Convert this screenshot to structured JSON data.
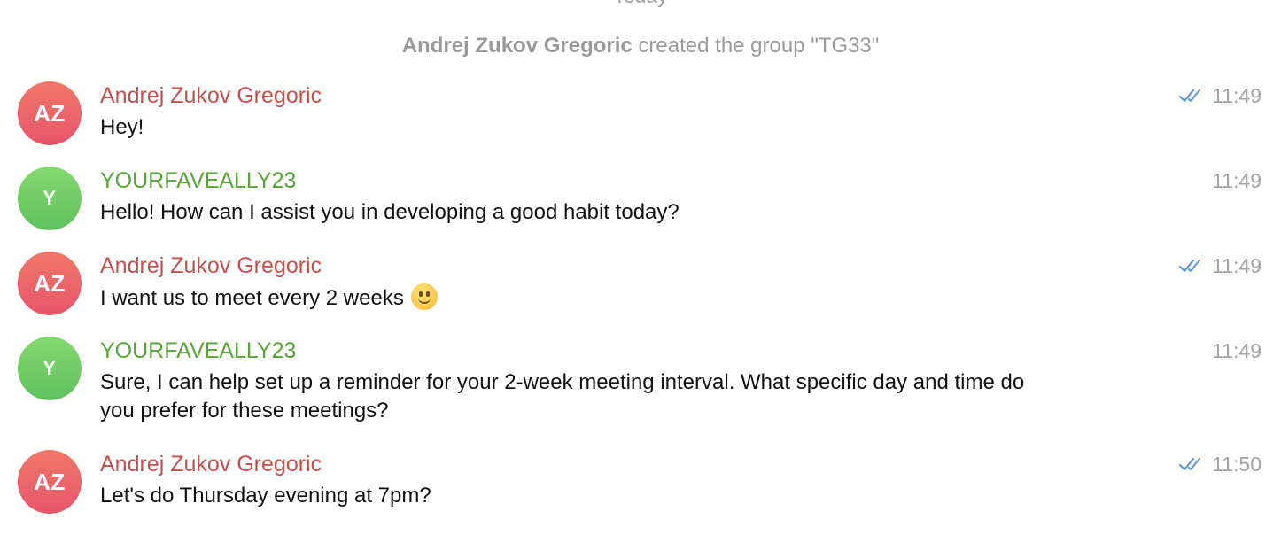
{
  "date_separator": "Today",
  "service_message": {
    "actor": "Andrej Zukov Gregoric",
    "text": " created the group \"TG33\""
  },
  "messages": [
    {
      "avatar_initials": "AZ",
      "sender": "Andrej Zukov Gregoric",
      "text": "Hey!",
      "time": "11:49",
      "read": true
    },
    {
      "avatar_initials": "Y",
      "sender": "YOURFAVEALLY23",
      "text": "Hello! How can I assist you in developing a good habit today?",
      "time": "11:49",
      "read": false
    },
    {
      "avatar_initials": "AZ",
      "sender": "Andrej Zukov Gregoric",
      "text": "I want us to meet every 2 weeks",
      "emoji": "slightly-smiling-face",
      "time": "11:49",
      "read": true
    },
    {
      "avatar_initials": "Y",
      "sender": "YOURFAVEALLY23",
      "text_line1": "Sure, I can help set up a reminder for your 2-week meeting interval. What specific day and time do",
      "text_line2": "you prefer for these meetings?",
      "time": "11:49",
      "read": false
    },
    {
      "avatar_initials": "AZ",
      "sender": "Andrej Zukov Gregoric",
      "text": "Let's do Thursday evening at 7pm?",
      "time": "11:50",
      "read": true
    }
  ],
  "colors": {
    "sender_red": "#c7504c",
    "sender_green": "#56a637",
    "read_checks": "#6b9be0",
    "meta_gray": "#a3a3a3"
  }
}
